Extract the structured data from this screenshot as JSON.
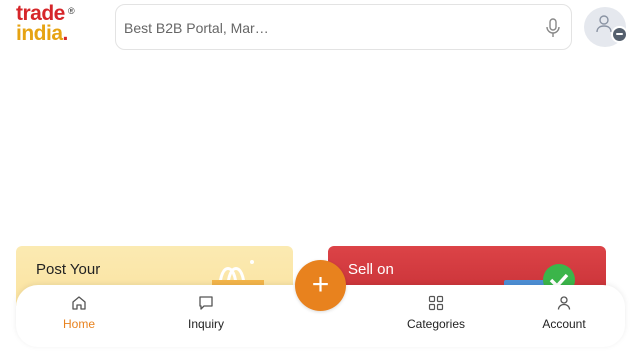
{
  "logo": {
    "line1": "trade",
    "line2": "india",
    "dot": ".",
    "registered": "®"
  },
  "search": {
    "placeholder": "Best B2B Portal, Mar…",
    "value": ""
  },
  "banners": [
    {
      "title": "Post Your"
    },
    {
      "title": "Sell on"
    }
  ],
  "fab": {
    "label": "+"
  },
  "nav": {
    "items": [
      {
        "label": "Home",
        "icon": "home-icon",
        "active": true
      },
      {
        "label": "Inquiry",
        "icon": "chat-icon",
        "active": false
      },
      {
        "label": "Categories",
        "icon": "grid-icon",
        "active": false
      },
      {
        "label": "Account",
        "icon": "user-icon",
        "active": false
      }
    ]
  },
  "colors": {
    "accent": "#e8821e",
    "brand_red": "#d6262a",
    "brand_yellow": "#e6a312"
  }
}
